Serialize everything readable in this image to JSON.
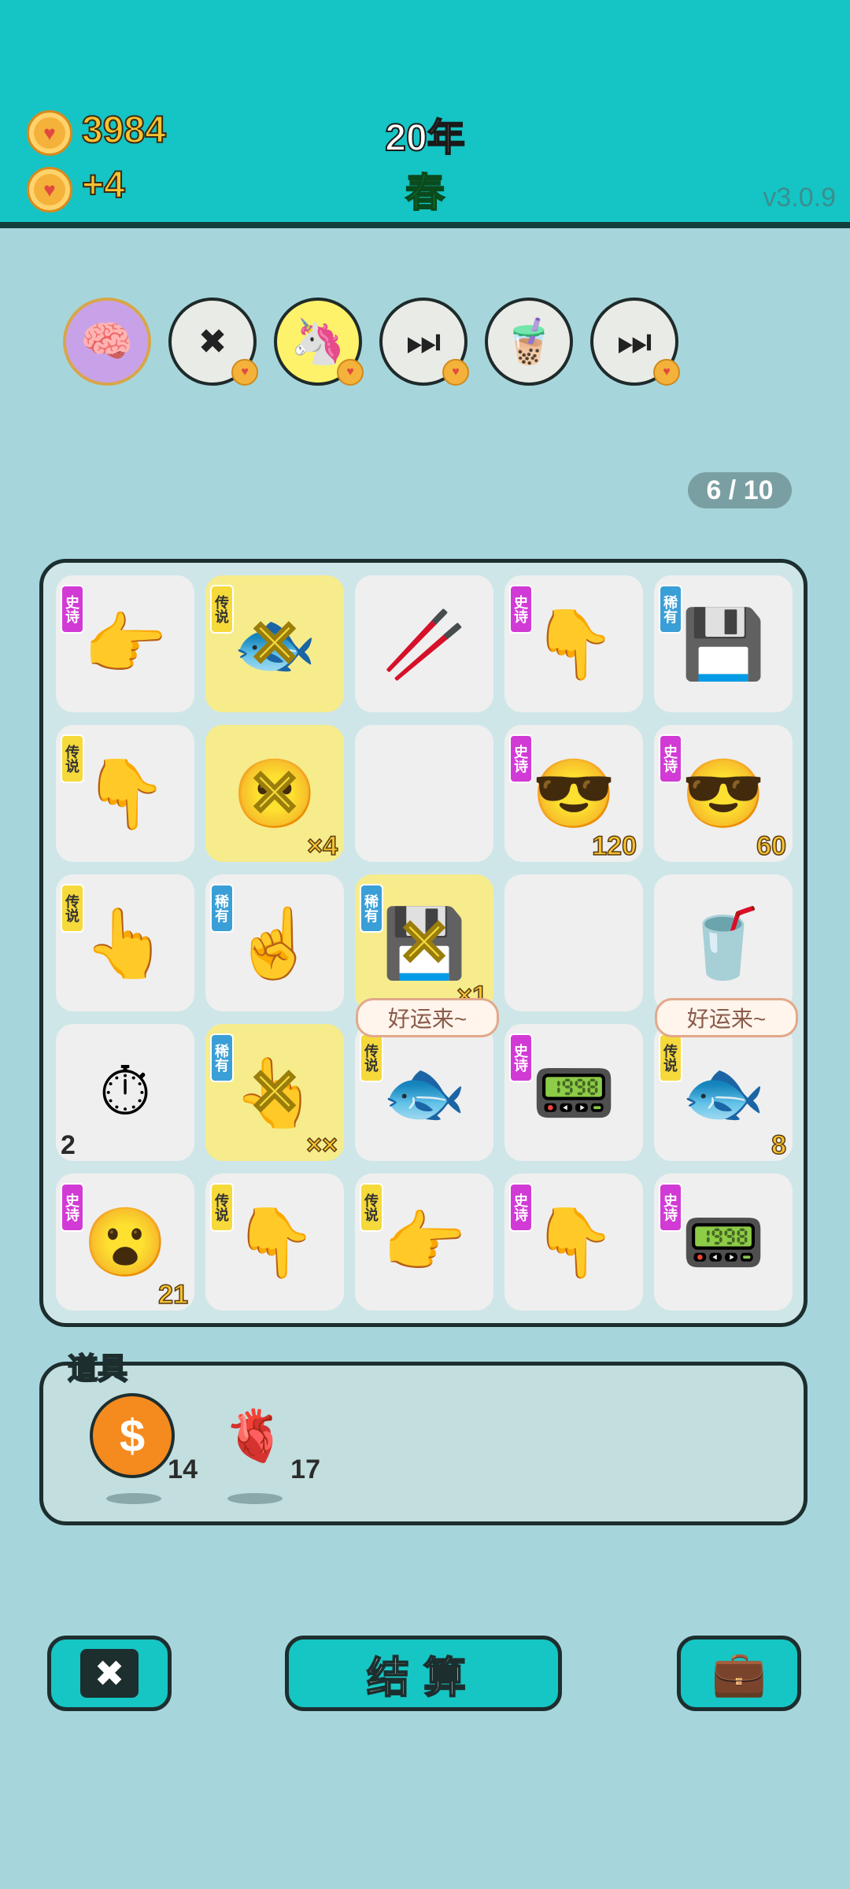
{
  "header": {
    "coins": "3984",
    "income": "+4",
    "year": "20年",
    "season": "春",
    "version": "v3.0.9"
  },
  "symbol_slots": [
    {
      "name": "math-brain-avatar",
      "icon": "glasses-man-icon",
      "glyph": "🧠"
    },
    {
      "name": "remove-card",
      "icon": "remove-x-icon",
      "glyph": "✖"
    },
    {
      "name": "unicorn",
      "icon": "unicorn-icon",
      "glyph": "🦄"
    },
    {
      "name": "skip-card",
      "icon": "skip-icon",
      "glyph": "⏭"
    },
    {
      "name": "bubble-tea",
      "icon": "bubble-tea-icon",
      "glyph": "🧋"
    },
    {
      "name": "skip-card-2",
      "icon": "skip-icon",
      "glyph": "⏭"
    }
  ],
  "counter": "6 / 10",
  "rarity_labels": {
    "epic": "史诗",
    "legend": "传说",
    "rare": "稀有"
  },
  "board": [
    [
      {
        "tag": "epic",
        "icon": "pointing-hand-icon",
        "glyph": "👉",
        "highlight": false,
        "num": "",
        "destroyed": false
      },
      {
        "tag": "legend",
        "icon": "koi-fish-icon",
        "glyph": "🐟",
        "highlight": true,
        "num": "",
        "destroyed": true
      },
      {
        "tag": "",
        "icon": "straw-icon",
        "glyph": "🥢",
        "highlight": false,
        "num": "",
        "destroyed": false
      },
      {
        "tag": "epic",
        "icon": "pointing-hand-icon",
        "glyph": "👇",
        "highlight": false,
        "num": "",
        "destroyed": false
      },
      {
        "tag": "rare",
        "icon": "cpu-icon",
        "glyph": "💾",
        "highlight": false,
        "num": "",
        "destroyed": false
      }
    ],
    [
      {
        "tag": "legend",
        "icon": "pointing-hand-icon",
        "glyph": "👇",
        "highlight": false,
        "num": "",
        "destroyed": false
      },
      {
        "tag": "",
        "icon": "face-icon",
        "glyph": "😶",
        "highlight": true,
        "num": "×4",
        "destroyed": true
      },
      {
        "tag": "",
        "icon": "",
        "glyph": "",
        "highlight": false,
        "num": "",
        "destroyed": false
      },
      {
        "tag": "epic",
        "icon": "glasses-man-icon",
        "glyph": "😎",
        "highlight": false,
        "num": "120",
        "destroyed": false
      },
      {
        "tag": "epic",
        "icon": "glasses-man-icon",
        "glyph": "😎",
        "highlight": false,
        "num": "60",
        "destroyed": false
      }
    ],
    [
      {
        "tag": "legend",
        "icon": "pointing-hand-icon",
        "glyph": "👆",
        "highlight": false,
        "num": "",
        "destroyed": false
      },
      {
        "tag": "rare",
        "icon": "pointing-hand-icon",
        "glyph": "☝",
        "highlight": false,
        "num": "",
        "destroyed": false
      },
      {
        "tag": "rare",
        "icon": "cpu-icon",
        "glyph": "💾",
        "highlight": true,
        "num": "×1",
        "destroyed": true
      },
      {
        "tag": "",
        "icon": "",
        "glyph": "",
        "highlight": false,
        "num": "",
        "destroyed": false
      },
      {
        "tag": "",
        "icon": "soda-cup-icon",
        "glyph": "🥤",
        "highlight": false,
        "num": "",
        "destroyed": false
      }
    ],
    [
      {
        "tag": "",
        "icon": "stopwatch-icon",
        "glyph": "⏱",
        "highlight": false,
        "num": "2",
        "destroyed": false,
        "dark": true
      },
      {
        "tag": "rare",
        "icon": "pointing-hand-icon",
        "glyph": "👆",
        "highlight": true,
        "num": "××",
        "destroyed": true
      },
      {
        "tag": "legend",
        "icon": "koi-fish-icon",
        "glyph": "🐟",
        "highlight": false,
        "num": "",
        "destroyed": false
      },
      {
        "tag": "epic",
        "icon": "graphics-card-icon",
        "glyph": "📟",
        "highlight": false,
        "num": "",
        "destroyed": false
      },
      {
        "tag": "legend",
        "icon": "koi-fish-icon",
        "glyph": "🐟",
        "highlight": false,
        "num": "8",
        "destroyed": false
      }
    ],
    [
      {
        "tag": "epic",
        "icon": "bald-face-icon",
        "glyph": "😮",
        "highlight": false,
        "num": "21",
        "destroyed": false
      },
      {
        "tag": "legend",
        "icon": "pointing-hand-icon",
        "glyph": "👇",
        "highlight": false,
        "num": "",
        "destroyed": false
      },
      {
        "tag": "legend",
        "icon": "pointing-hand-icon",
        "glyph": "👉",
        "highlight": false,
        "num": "",
        "destroyed": false
      },
      {
        "tag": "epic",
        "icon": "pointing-hand-icon",
        "glyph": "👇",
        "highlight": false,
        "num": "",
        "destroyed": false
      },
      {
        "tag": "epic",
        "icon": "graphics-card-icon",
        "glyph": "📟",
        "highlight": false,
        "num": "",
        "destroyed": false
      }
    ]
  ],
  "bubbles": [
    "好运来~",
    "好运来~"
  ],
  "props": {
    "label": "道具",
    "items": [
      {
        "icon": "dollar-coin-icon",
        "glyph": "$",
        "count": "14"
      },
      {
        "icon": "liver-icon",
        "glyph": "🫀",
        "count": "17"
      }
    ]
  },
  "buttons": {
    "remove_glyph": "✖",
    "settle_label": "结算",
    "bag_glyph": "💼"
  },
  "colors": {
    "header": "#15c4c5",
    "background": "#a6d6dc",
    "accent": "#16c6c4",
    "coin": "#f4b23a"
  }
}
